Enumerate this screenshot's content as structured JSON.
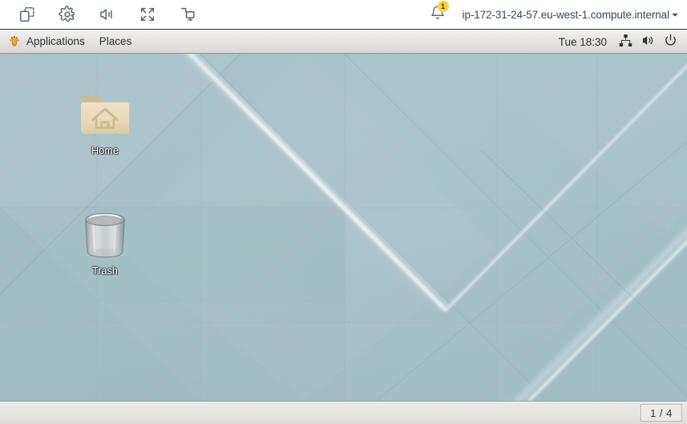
{
  "toolbar": {
    "buttons": [
      {
        "name": "duplicate-tab-icon",
        "label": "Duplicate"
      },
      {
        "name": "settings-gear-icon",
        "label": "Settings"
      },
      {
        "name": "volume-icon",
        "label": "Volume"
      },
      {
        "name": "fullscreen-icon",
        "label": "Fullscreen"
      },
      {
        "name": "screen-share-icon",
        "label": "Display"
      }
    ],
    "notifications": {
      "icon": "bell-icon",
      "count": "1"
    },
    "hostname": "ip-172-31-24-57.eu-west-1.compute.internal",
    "caret": "▾"
  },
  "panel": {
    "logo_icon": "mate-logo-icon",
    "menus": [
      {
        "label": "Applications"
      },
      {
        "label": "Places"
      }
    ],
    "clock": "Tue 18:30",
    "tray": [
      {
        "name": "network-icon",
        "label": "Network"
      },
      {
        "name": "volume-icon",
        "label": "Volume"
      },
      {
        "name": "power-icon",
        "label": "Power"
      }
    ]
  },
  "desktop": {
    "icons": [
      {
        "name": "home-folder-icon",
        "label": "Home",
        "glyph": "folder-home"
      },
      {
        "name": "trash-icon",
        "label": "Trash",
        "glyph": "trash-can"
      }
    ]
  },
  "bottom_panel": {
    "workspace": "1 / 4"
  },
  "colors": {
    "wallpaper_top": "#a9c0ca",
    "wallpaper_mid": "#a6c3c6",
    "wallpaper_bottom": "#9fb9c4",
    "panel_bg": "#e4e2e0",
    "badge": "#ffd43b",
    "folder": "#e8d8ba",
    "text": "#2e3436"
  }
}
